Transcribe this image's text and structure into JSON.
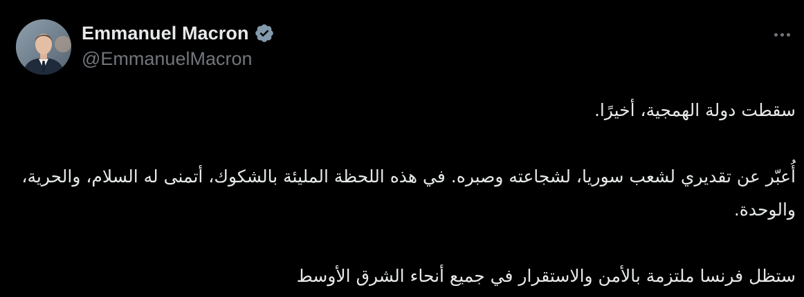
{
  "author": {
    "display_name": "Emmanuel Macron",
    "handle": "@EmmanuelMacron",
    "verified_icon": "verified-badge-icon",
    "avatar_icon": "profile-photo"
  },
  "menu": {
    "more_icon": "more-options-icon"
  },
  "tweet": {
    "paragraphs": [
      "سقطت دولة الهمجية، أخيرًا.",
      "أُعبّر عن تقديري لشعب سوريا، لشجاعته وصبره. في هذه اللحظة المليئة بالشكوك، أتمنى له السلام، والحرية، والوحدة.",
      "ستظل فرنسا ملتزمة بالأمن والاستقرار في جميع أنحاء الشرق الأوسط"
    ]
  },
  "colors": {
    "background": "#000000",
    "text_primary": "#e7e9ea",
    "text_secondary": "#71767b",
    "verified": "#829aab"
  }
}
